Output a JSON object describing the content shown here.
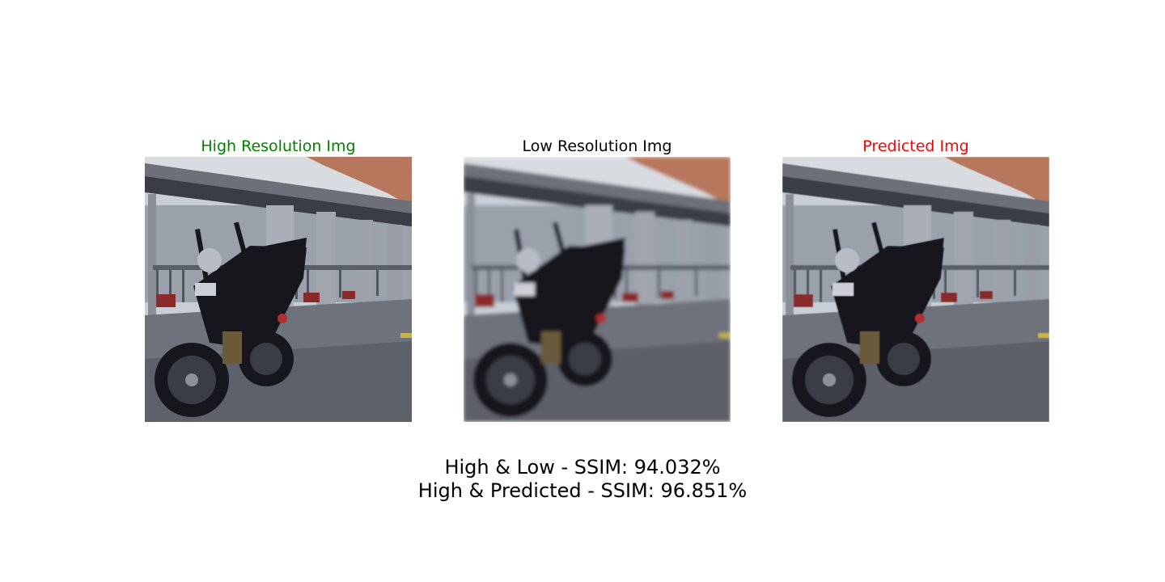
{
  "panels": [
    {
      "title": "High Resolution Img",
      "title_color": "#008000",
      "image": "motorcycle-photo-sharp"
    },
    {
      "title": "Low Resolution Img",
      "title_color": "#000000",
      "image": "motorcycle-photo-blurred"
    },
    {
      "title": "Predicted Img",
      "title_color": "#ff0000",
      "image": "motorcycle-photo-predicted"
    }
  ],
  "metrics": {
    "line1": "High & Low - SSIM: 94.032%",
    "line2": "High & Predicted - SSIM: 96.851%"
  }
}
